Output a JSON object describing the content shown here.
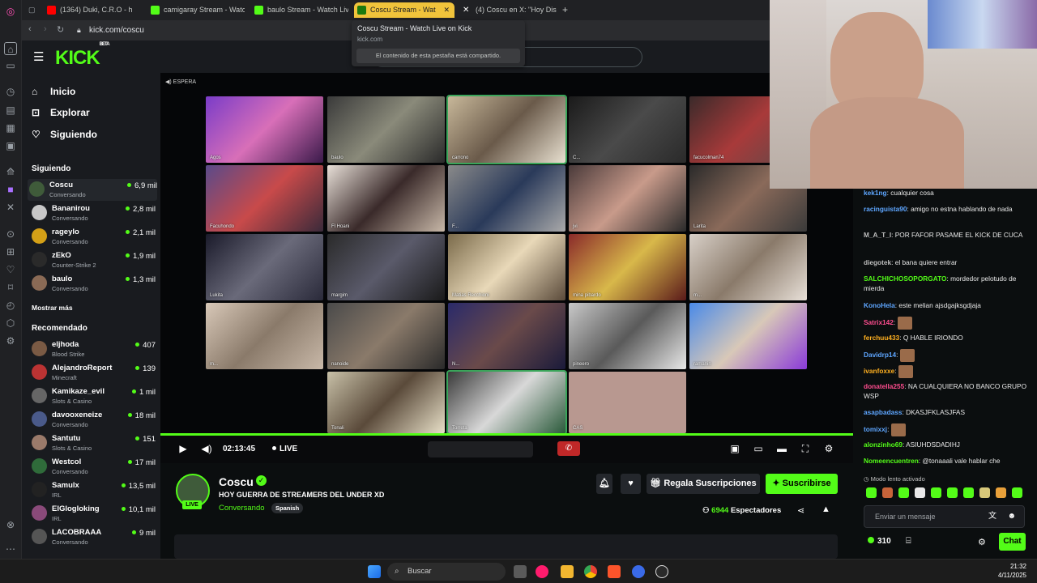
{
  "browser": {
    "tabs": [
      {
        "label": "(1364) Duki, C.R.O - h",
        "color": "#ff0000"
      },
      {
        "label": "camigaray Stream - Watc",
        "color": "#53fc18"
      },
      {
        "label": "baulo Stream - Watch Liv",
        "color": "#53fc18"
      },
      {
        "label": "Coscu Stream - Wat",
        "color": "#53fc18"
      },
      {
        "label": "(4) Coscu en X: \"Hoy Dis",
        "color": "#ffffff"
      }
    ],
    "url": "kick.com/coscu",
    "tooltip": {
      "title": "Coscu Stream - Watch Live on Kick",
      "domain": "kick.com",
      "note": "El contenido de esta pestaña está compartido."
    }
  },
  "kick": {
    "logo": "KICK",
    "logo_sup": "BETA",
    "nav": [
      {
        "label": "Inicio",
        "icon": "home-icon"
      },
      {
        "label": "Explorar",
        "icon": "compass-icon"
      },
      {
        "label": "Siguiendo",
        "icon": "heart-icon"
      }
    ],
    "following_title": "Siguiendo",
    "following": [
      {
        "name": "Coscu",
        "category": "Conversando",
        "viewers": "6,9 mil"
      },
      {
        "name": "Bananirou",
        "category": "Conversando",
        "viewers": "2,8 mil"
      },
      {
        "name": "rageylo",
        "category": "Conversando",
        "viewers": "2,1 mil"
      },
      {
        "name": "zEkO",
        "category": "Counter-Strike 2",
        "viewers": "1,9 mil"
      },
      {
        "name": "baulo",
        "category": "Conversando",
        "viewers": "1,3 mil"
      }
    ],
    "show_more": "Mostrar más",
    "recommended_title": "Recomendado",
    "recommended": [
      {
        "name": "eljhoda",
        "category": "Blood Strike",
        "viewers": "407"
      },
      {
        "name": "AlejandroReport",
        "category": "Minecraft",
        "viewers": "139"
      },
      {
        "name": "Kamikaze_evil",
        "category": "Slots & Casino",
        "viewers": "1 mil"
      },
      {
        "name": "davooxeneize",
        "category": "Conversando",
        "viewers": "18 mil"
      },
      {
        "name": "Santutu",
        "category": "Slots & Casino",
        "viewers": "151"
      },
      {
        "name": "Westcol",
        "category": "Conversando",
        "viewers": "17 mil"
      },
      {
        "name": "Samulx",
        "category": "IRL",
        "viewers": "13,5 mil"
      },
      {
        "name": "ElGlogloking",
        "category": "IRL",
        "viewers": "10,1 mil"
      },
      {
        "name": "LACOBRAAA",
        "category": "Conversando",
        "viewers": "9 mil"
      }
    ]
  },
  "player": {
    "waiting": "ESPERA",
    "tiles": [
      {
        "label": "Agos"
      },
      {
        "label": "baulo"
      },
      {
        "label": "carrono"
      },
      {
        "label": "C..."
      },
      {
        "label": "facucolman74"
      },
      {
        "label": "Facuhondo"
      },
      {
        "label": "Fl Hoani"
      },
      {
        "label": "F..."
      },
      {
        "label": "jvi"
      },
      {
        "label": "Larita"
      },
      {
        "label": "Lukita"
      },
      {
        "label": "margim"
      },
      {
        "label": "Matias Recchioni"
      },
      {
        "label": "mina pibardo"
      },
      {
        "label": "m..."
      },
      {
        "label": "m..."
      },
      {
        "label": "nanoide"
      },
      {
        "label": "N..."
      },
      {
        "label": "pineero"
      },
      {
        "label": "ramanin"
      },
      {
        "label": "Tonali"
      },
      {
        "label": "Torreta"
      },
      {
        "label": "CAS"
      }
    ],
    "time": "02:13:45",
    "live": "LIVE"
  },
  "channel": {
    "name": "Coscu",
    "live_badge": "LIVE",
    "title": "HOY GUERRA DE STREAMERS DEL UNDER XD",
    "category": "Conversando",
    "language": "Spanish",
    "gift_label": "Regala Suscripciones",
    "subscribe_label": "Suscribirse",
    "viewers_count": "6944",
    "viewers_label": "Espectadores"
  },
  "chat": {
    "messages": [
      {
        "user": "kek1ng",
        "text": "cualquier cosa",
        "color": "#5ea6ff"
      },
      {
        "user": "racinguista90",
        "text": "amigo no estna hablando de nada",
        "color": "#5ea6ff"
      },
      {
        "user": "M_A_T_I",
        "text": "POR FAFOR PASAME EL KICK DE CUCA",
        "color": "#bdbdbd"
      },
      {
        "user": "diegotek",
        "text": "el bana quiere entrar",
        "color": "#bdbdbd"
      },
      {
        "user": "SALCHICHOSOPORGATO",
        "text": "mordedor pelotudo de mierda",
        "color": "#53fc18"
      },
      {
        "user": "KonoHela",
        "text": "este melian ajsdgajksgdjaja",
        "color": "#5ea6ff"
      },
      {
        "user": "Satrix142",
        "text": "",
        "color": "#ff4d8f"
      },
      {
        "user": "ferchuu433",
        "text": "Q HABLE IRIONDO",
        "color": "#ffb020"
      },
      {
        "user": "Davidrp14",
        "text": "",
        "color": "#5ea6ff"
      },
      {
        "user": "ivanfoxxe",
        "text": "",
        "color": "#ffb020"
      },
      {
        "user": "donatella255",
        "text": "NA CUALQUIERA NO BANCO GRUPO WSP",
        "color": "#ff4d8f"
      },
      {
        "user": "asapbadass",
        "text": "DKASJFKLASJFAS",
        "color": "#5ea6ff"
      },
      {
        "user": "tomixxj",
        "text": "",
        "color": "#5ea6ff"
      },
      {
        "user": "alonzinho69",
        "text": "ASIUHDSDADIHJ",
        "color": "#53fc18"
      },
      {
        "user": "Nomeencuentren",
        "text": "@tonaaali vale hablar che",
        "color": "#53fc18"
      }
    ],
    "slow_mode": "Modo lento activado",
    "input_placeholder": "Enviar un mensaje",
    "points": "310",
    "send_label": "Chat"
  },
  "taskbar": {
    "search": "Buscar",
    "time": "21:32",
    "date": "4/11/2025"
  }
}
